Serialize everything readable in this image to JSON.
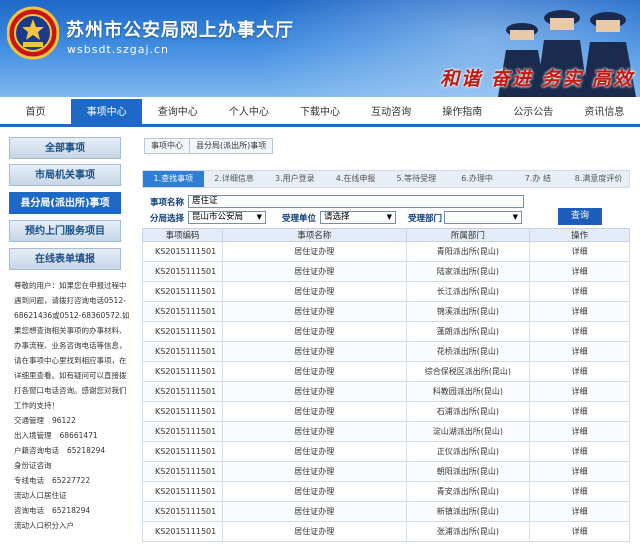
{
  "header": {
    "title": "苏州市公安局网上办事大厅",
    "url": "wsbsdt.szgaj.cn",
    "slogan": "和谐 奋进 务实 高效"
  },
  "nav": [
    "首页",
    "事项中心",
    "查询中心",
    "个人中心",
    "下载中心",
    "互动咨询",
    "操作指南",
    "公示公告",
    "资讯信息"
  ],
  "sidebar": {
    "items": [
      "全部事项",
      "市局机关事项",
      "县分局(派出所)事项",
      "预约上门服务项目",
      "在线表单填报"
    ],
    "note": "尊敬的用户：如果您在申报过程中遇到问题，请拨打咨询电话0512-68621436或0512-68360572.如果您想查询相关事项的办事材料、办事流程、业务咨询电话等信息，请在事项中心里找到相应事项，在详细里查看。如有疑问可以直接拨打各窗口电话咨询。感谢您对我们工作的支持！",
    "contacts": [
      {
        "label": "交通管理",
        "phone": "96122"
      },
      {
        "label": "出入境管理",
        "phone": "68661471"
      },
      {
        "label": "户籍咨询电话",
        "phone": "65218294"
      },
      {
        "label": "身份证咨询",
        "phone": ""
      },
      {
        "label": "专线电话",
        "phone": "65227722"
      },
      {
        "label": "流动人口居住证",
        "phone": ""
      },
      {
        "label": "咨询电话",
        "phone": "65218294"
      },
      {
        "label": "流动人口积分入户",
        "phone": ""
      }
    ]
  },
  "breadcrumb": [
    "事项中心",
    "县分局(派出所)事项"
  ],
  "steps": [
    "1.查找事项",
    "2.详细信息",
    "3.用户登录",
    "4.在线申报",
    "5.等待受理",
    "6.办理中",
    "7.办 结",
    "8.满意度评价"
  ],
  "form": {
    "name_label": "事项名称",
    "name_value": "居住证",
    "branch_label": "分局选择",
    "branch_value": "昆山市公安局",
    "unit_label": "受理单位",
    "unit_value": "请选择",
    "dept_label": "受理部门",
    "dept_value": "",
    "query_label": "查询"
  },
  "table": {
    "headers": [
      "事项编码",
      "事项名称",
      "所属部门",
      "操作"
    ],
    "rows": [
      [
        "KS2015111501",
        "居住证办理",
        "青阳派出所(昆山)",
        "详细"
      ],
      [
        "KS2015111501",
        "居住证办理",
        "陆家派出所(昆山)",
        "详细"
      ],
      [
        "KS2015111501",
        "居住证办理",
        "长江派出所(昆山)",
        "详细"
      ],
      [
        "KS2015111501",
        "居住证办理",
        "锦溪派出所(昆山)",
        "详细"
      ],
      [
        "KS2015111501",
        "居住证办理",
        "蓬朗派出所(昆山)",
        "详细"
      ],
      [
        "KS2015111501",
        "居住证办理",
        "花桥派出所(昆山)",
        "详细"
      ],
      [
        "KS2015111501",
        "居住证办理",
        "综合保税区派出所(昆山)",
        "详细"
      ],
      [
        "KS2015111501",
        "居住证办理",
        "科教园派出所(昆山)",
        "详细"
      ],
      [
        "KS2015111501",
        "居住证办理",
        "石浦派出所(昆山)",
        "详细"
      ],
      [
        "KS2015111501",
        "居住证办理",
        "淀山湖派出所(昆山)",
        "详细"
      ],
      [
        "KS2015111501",
        "居住证办理",
        "正仪派出所(昆山)",
        "详细"
      ],
      [
        "KS2015111501",
        "居住证办理",
        "朝阳派出所(昆山)",
        "详细"
      ],
      [
        "KS2015111501",
        "居住证办理",
        "青安派出所(昆山)",
        "详细"
      ],
      [
        "KS2015111501",
        "居住证办理",
        "新镇派出所(昆山)",
        "详细"
      ],
      [
        "KS2015111501",
        "居住证办理",
        "张浦派出所(昆山)",
        "详细"
      ]
    ]
  }
}
